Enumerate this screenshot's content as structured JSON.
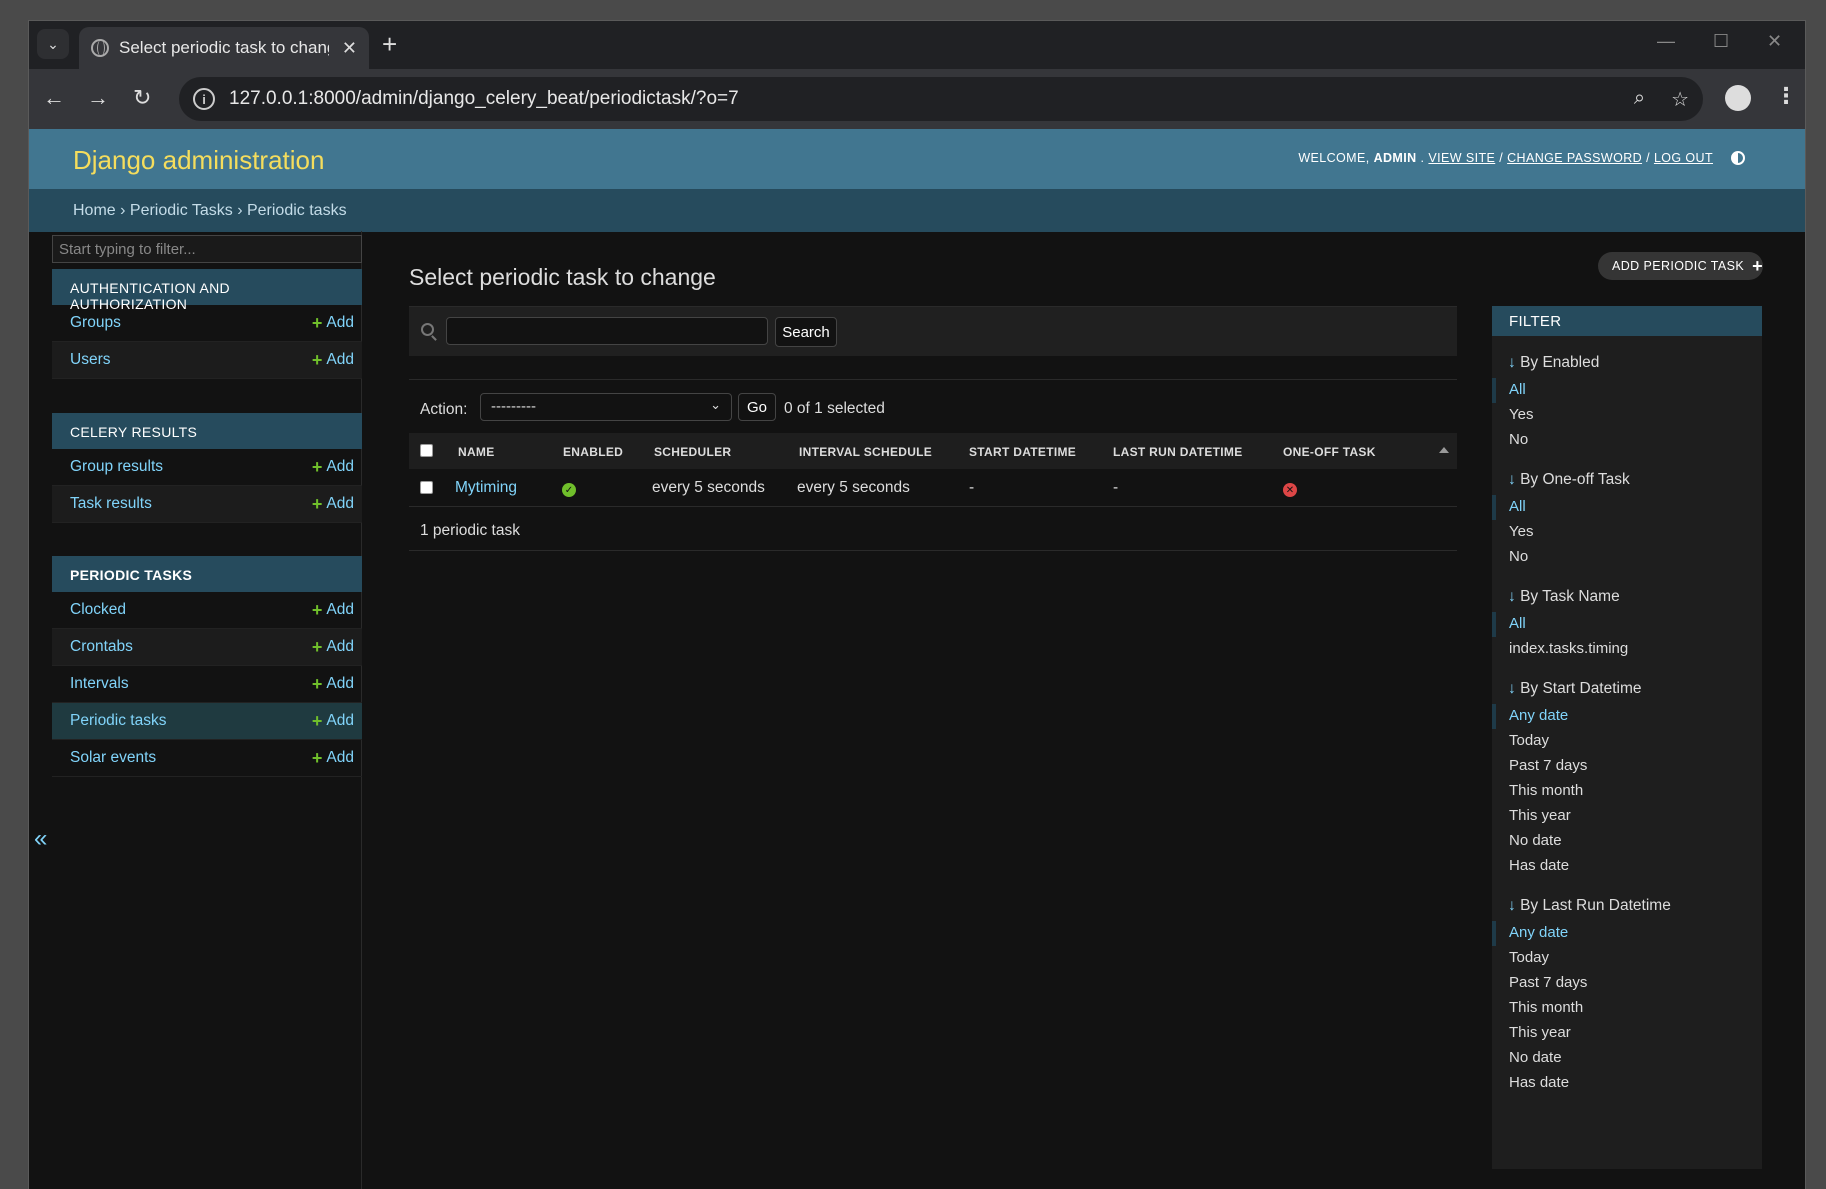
{
  "browser": {
    "tab_title": "Select periodic task to chang",
    "url": "127.0.0.1:8000/admin/django_celery_beat/periodictask/?o=7"
  },
  "header": {
    "brand": "Django administration",
    "welcome": "WELCOME,",
    "user": "ADMIN",
    "view_site": "VIEW SITE",
    "change_password": "CHANGE PASSWORD",
    "log_out": "LOG OUT"
  },
  "breadcrumbs": "Home › Periodic Tasks › Periodic tasks",
  "sidebar": {
    "filter_placeholder": "Start typing to filter...",
    "add_label": "Add",
    "modules": [
      {
        "caption": "AUTHENTICATION AND AUTHORIZATION",
        "items": [
          "Groups",
          "Users"
        ]
      },
      {
        "caption": "CELERY RESULTS",
        "items": [
          "Group results",
          "Task results"
        ]
      },
      {
        "caption": "PERIODIC TASKS",
        "items": [
          "Clocked",
          "Crontabs",
          "Intervals",
          "Periodic tasks",
          "Solar events"
        ]
      }
    ],
    "collapse": "«"
  },
  "content": {
    "title": "Select periodic task to change",
    "add_button": "ADD PERIODIC TASK",
    "search_button": "Search",
    "action_label": "Action:",
    "action_value": "---------",
    "go_button": "Go",
    "selected_count": "0 of 1 selected",
    "columns": [
      "NAME",
      "ENABLED",
      "SCHEDULER",
      "INTERVAL SCHEDULE",
      "START DATETIME",
      "LAST RUN DATETIME",
      "ONE-OFF TASK"
    ],
    "rows": [
      {
        "name": "Mytiming",
        "enabled": true,
        "scheduler": "every 5 seconds",
        "interval": "every 5 seconds",
        "start": "-",
        "last_run": "-",
        "one_off": false
      }
    ],
    "paginator": "1 periodic task"
  },
  "filter": {
    "caption": "FILTER",
    "groups": [
      {
        "title": "By Enabled",
        "items": [
          "All",
          "Yes",
          "No"
        ]
      },
      {
        "title": "By One-off Task",
        "items": [
          "All",
          "Yes",
          "No"
        ]
      },
      {
        "title": "By Task Name",
        "items": [
          "All",
          "index.tasks.timing"
        ]
      },
      {
        "title": "By Start Datetime",
        "items": [
          "Any date",
          "Today",
          "Past 7 days",
          "This month",
          "This year",
          "No date",
          "Has date"
        ]
      },
      {
        "title": "By Last Run Datetime",
        "items": [
          "Any date",
          "Today",
          "Past 7 days",
          "This month",
          "This year",
          "No date",
          "Has date"
        ]
      }
    ]
  },
  "colors": {
    "header": "#417690",
    "brand": "#f5dd5d",
    "link": "#81d4fa",
    "add_plus": "#70bf2b",
    "caption": "#264b5d"
  }
}
